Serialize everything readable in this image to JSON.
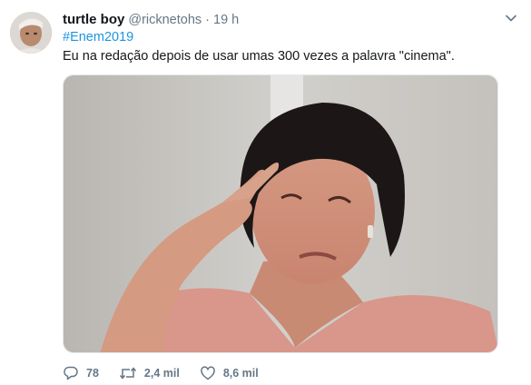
{
  "tweet": {
    "author_name": "turtle boy",
    "author_handle": "@ricknetohs",
    "separator": "·",
    "timestamp": "19 h",
    "hashtag": "#Enem2019",
    "text": "Eu na redação depois de usar umas 300 vezes a palavra \"cinema\".",
    "media_icon": "photo",
    "avatar_icon": "user-avatar"
  },
  "actions": {
    "reply_count": "78",
    "retweet_count": "2,4 mil",
    "like_count": "8,6 mil"
  },
  "colors": {
    "link": "#1b95e0",
    "secondary_text": "#657786",
    "primary_text": "#14171a"
  }
}
